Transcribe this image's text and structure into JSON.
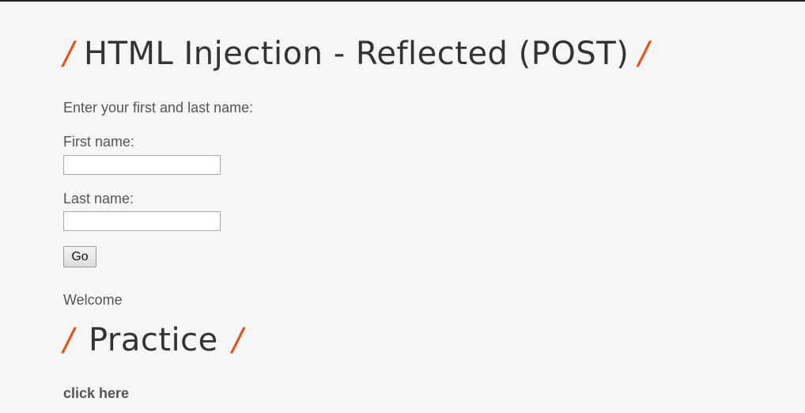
{
  "header": {
    "slash": "/",
    "title": "HTML Injection - Reflected (POST)"
  },
  "form": {
    "intro": "Enter your first and last name:",
    "first_name_label": "First name:",
    "first_name_value": "",
    "last_name_label": "Last name:",
    "last_name_value": "",
    "submit_label": "Go"
  },
  "result": {
    "welcome_text": "Welcome"
  },
  "practice": {
    "slash": "/",
    "title": "Practice",
    "link_text": "click here"
  },
  "colors": {
    "accent": "#e2531f",
    "text": "#555555",
    "heading": "#333333",
    "background": "#f6f6f6"
  }
}
